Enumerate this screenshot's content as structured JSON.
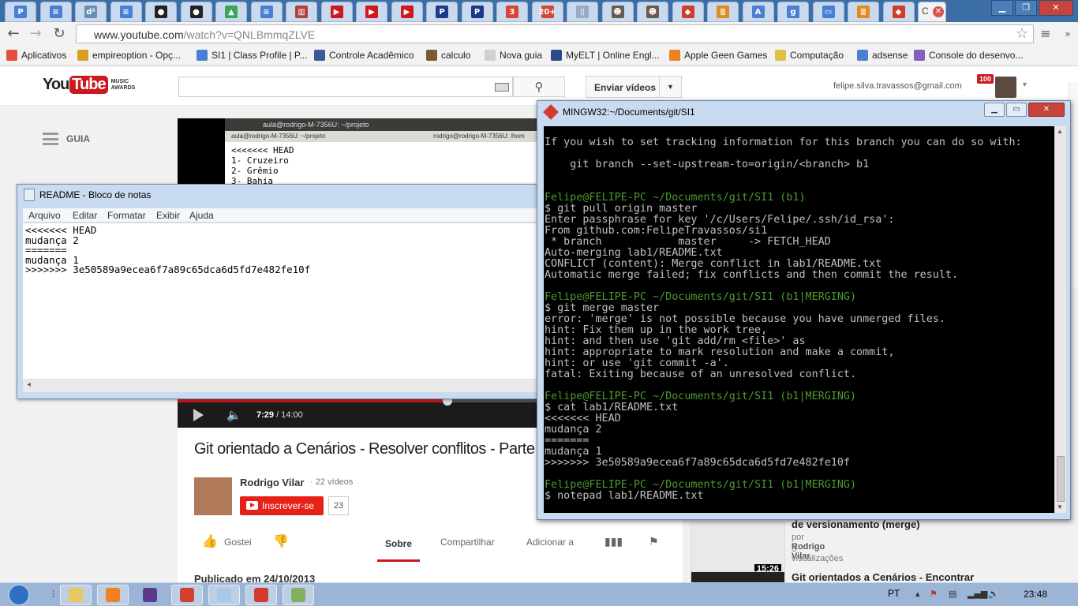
{
  "browser": {
    "url_host": "www.youtube.com",
    "url_path": "/watch?v=QNLBmmqZLVE",
    "tabs": [
      {
        "icon": "p-doc-icon",
        "color": "#4a7fd4",
        "glyph": "P"
      },
      {
        "icon": "docs-icon",
        "color": "#4a7fd4",
        "glyph": "≡"
      },
      {
        "icon": "d2-icon",
        "color": "#6a8fb5",
        "glyph": "d²"
      },
      {
        "icon": "docs-icon",
        "color": "#4a7fd4",
        "glyph": "≡"
      },
      {
        "icon": "github-icon",
        "color": "#222222",
        "glyph": "●"
      },
      {
        "icon": "github-icon",
        "color": "#222222",
        "glyph": "●"
      },
      {
        "icon": "drive-icon",
        "color": "#3aa757",
        "glyph": "▲"
      },
      {
        "icon": "docs-icon",
        "color": "#4a7fd4",
        "glyph": "≡"
      },
      {
        "icon": "books-icon",
        "color": "#b04040",
        "glyph": "▥"
      },
      {
        "icon": "youtube-icon",
        "color": "#cc181e",
        "glyph": "▶"
      },
      {
        "icon": "youtube-icon",
        "color": "#cc181e",
        "glyph": "▶"
      },
      {
        "icon": "youtube-icon",
        "color": "#cc181e",
        "glyph": "▶"
      },
      {
        "icon": "paypal-icon",
        "color": "#1a3a8a",
        "glyph": "P"
      },
      {
        "icon": "paypal-icon",
        "color": "#1a3a8a",
        "glyph": "P"
      },
      {
        "icon": "gmail-icon",
        "color": "#d44638",
        "glyph": "3"
      },
      {
        "icon": "gmail-icon",
        "color": "#d44638",
        "glyph": "20+"
      },
      {
        "icon": "page-icon",
        "color": "#9aaac0",
        "glyph": "▯"
      },
      {
        "icon": "avatar-icon",
        "color": "#6a5a50",
        "glyph": "☻"
      },
      {
        "icon": "avatar-icon",
        "color": "#6a5a50",
        "glyph": "☻"
      },
      {
        "icon": "git-icon",
        "color": "#d23c2f",
        "glyph": "◆"
      },
      {
        "icon": "stack-icon",
        "color": "#e08a20",
        "glyph": "≣"
      },
      {
        "icon": "translate-icon",
        "color": "#4a7fd4",
        "glyph": "A"
      },
      {
        "icon": "google-icon",
        "color": "#4a7fd4",
        "glyph": "g"
      },
      {
        "icon": "monitor-icon",
        "color": "#4a7fd4",
        "glyph": "▭"
      },
      {
        "icon": "stack-icon",
        "color": "#e08a20",
        "glyph": "≣"
      },
      {
        "icon": "git-icon",
        "color": "#d23c2f",
        "glyph": "◆"
      }
    ],
    "active_tab_glyph": "C",
    "bookmarks": [
      {
        "label": "Aplicativos",
        "color": "#e05040"
      },
      {
        "label": "empireoption - Opç...",
        "color": "#d8a020"
      },
      {
        "label": "SI1 | Class Profile | P...",
        "color": "#4a7fd4"
      },
      {
        "label": "Controle Acadêmico",
        "color": "#3a5a9a"
      },
      {
        "label": "calculo",
        "color": "#7a5a30"
      },
      {
        "label": "Nova guia",
        "color": "#d0d0d0"
      },
      {
        "label": "MyELT | Online Engl...",
        "color": "#2a4a8a"
      },
      {
        "label": "Apple Geen Games",
        "color": "#f08020"
      },
      {
        "label": "Computação",
        "color": "#e0c040"
      },
      {
        "label": "adsense",
        "color": "#4a7fd4"
      },
      {
        "label": "Console do desenvo...",
        "color": "#8060c0"
      }
    ]
  },
  "youtube": {
    "logo_you": "You",
    "logo_tube": "Tube",
    "logo_awards_1": "MUSIC",
    "logo_awards_2": "AWARDS",
    "upload_label": "Enviar vídeos",
    "user_email": "felipe.silva.travassos@gmail.com",
    "notifications": "100",
    "guide_label": "GUIA",
    "video_terminal_title": "aula@rodrigo-M-7356U: ~/projeto",
    "video_terminal_tab1": "aula@rodrigo-M-7356U: ~/projeto",
    "video_terminal_tab2": "rodrigo@rodrigo-M-7356U: /hom",
    "video_terminal_lines": [
      "<<<<<<< HEAD",
      "1- Cruzeiro",
      "2- Grêmio",
      "3- Bahia"
    ],
    "time_current": "7:29",
    "time_total": "/ 14:00",
    "progress_fraction": 0.535,
    "title": "Git orientado a Cenários - Resolver conflitos - Parte",
    "channel_name": "Rodrigo Vilar",
    "channel_videos": "· 22 vídeos",
    "subscribe_label": "Inscrever-se",
    "subscriber_count": "23",
    "like_label": "Gostei",
    "tab_about": "Sobre",
    "tab_share": "Compartilhar",
    "tab_add": "Adicionar a",
    "published": "Publicado em 24/10/2013",
    "related": [
      {
        "title": "de versionamento (merge)",
        "by_prefix": "por",
        "by": "Rodrigo Vilar",
        "views": "5 visualizações",
        "duration": "15:26"
      },
      {
        "title": "Git orientados a Cenários - Encontrar"
      }
    ]
  },
  "notepad": {
    "title": "README - Bloco de notas",
    "menu": [
      "Arquivo",
      "Editar",
      "Formatar",
      "Exibir",
      "Ajuda"
    ],
    "lines": [
      "<<<<<<< HEAD",
      "mudança 2",
      "=======",
      "mudança 1",
      ">>>>>>> 3e50589a9ecea6f7a89c65dca6d5fd7e482fe10f"
    ]
  },
  "terminal": {
    "title": "MINGW32:~/Documents/git/SI1",
    "lines": [
      {
        "t": "",
        "c": ""
      },
      {
        "t": "If you wish to set tracking information for this branch you can do so with:",
        "c": ""
      },
      {
        "t": "",
        "c": ""
      },
      {
        "t": "    git branch --set-upstream-to=origin/<branch> b1",
        "c": ""
      },
      {
        "t": "",
        "c": ""
      },
      {
        "t": "",
        "c": ""
      },
      {
        "t": "Felipe@FELIPE-PC ~/Documents/git/SI1 (b1)",
        "c": "g"
      },
      {
        "t": "$ git pull origin master",
        "c": ""
      },
      {
        "t": "Enter passphrase for key '/c/Users/Felipe/.ssh/id_rsa':",
        "c": ""
      },
      {
        "t": "From github.com:FelipeTravassos/si1",
        "c": ""
      },
      {
        "t": " * branch            master     -> FETCH_HEAD",
        "c": ""
      },
      {
        "t": "Auto-merging lab1/README.txt",
        "c": ""
      },
      {
        "t": "CONFLICT (content): Merge conflict in lab1/README.txt",
        "c": ""
      },
      {
        "t": "Automatic merge failed; fix conflicts and then commit the result.",
        "c": ""
      },
      {
        "t": "",
        "c": ""
      },
      {
        "t": "Felipe@FELIPE-PC ~/Documents/git/SI1 (b1|MERGING)",
        "c": "g"
      },
      {
        "t": "$ git merge master",
        "c": ""
      },
      {
        "t": "error: 'merge' is not possible because you have unmerged files.",
        "c": ""
      },
      {
        "t": "hint: Fix them up in the work tree,",
        "c": ""
      },
      {
        "t": "hint: and then use 'git add/rm <file>' as",
        "c": ""
      },
      {
        "t": "hint: appropriate to mark resolution and make a commit,",
        "c": ""
      },
      {
        "t": "hint: or use 'git commit -a'.",
        "c": ""
      },
      {
        "t": "fatal: Exiting because of an unresolved conflict.",
        "c": ""
      },
      {
        "t": "",
        "c": ""
      },
      {
        "t": "Felipe@FELIPE-PC ~/Documents/git/SI1 (b1|MERGING)",
        "c": "g"
      },
      {
        "t": "$ cat lab1/README.txt",
        "c": ""
      },
      {
        "t": "<<<<<<< HEAD",
        "c": ""
      },
      {
        "t": "mudança 2",
        "c": ""
      },
      {
        "t": "=======",
        "c": ""
      },
      {
        "t": "mudança 1",
        "c": ""
      },
      {
        "t": ">>>>>>> 3e50589a9ecea6f7a89c65dca6d5fd7e482fe10f",
        "c": ""
      },
      {
        "t": "",
        "c": ""
      },
      {
        "t": "Felipe@FELIPE-PC ~/Documents/git/SI1 (b1|MERGING)",
        "c": "g"
      },
      {
        "t": "$ notepad lab1/README.txt",
        "c": ""
      }
    ]
  },
  "taskbar": {
    "language": "PT",
    "time": "23:48",
    "apps": [
      {
        "icon": "explorer-icon",
        "color": "#e8c860",
        "open": true
      },
      {
        "icon": "media-player-icon",
        "color": "#f08020",
        "open": true
      },
      {
        "icon": "eclipse-icon",
        "color": "#5a3a8a",
        "open": false
      },
      {
        "icon": "chrome-icon",
        "color": "#d04030",
        "open": true
      },
      {
        "icon": "notepad-icon",
        "color": "#a8c8e8",
        "open": true
      },
      {
        "icon": "git-bash-icon",
        "color": "#d23c2f",
        "open": true
      },
      {
        "icon": "paint-icon",
        "color": "#80b060",
        "open": true
      }
    ]
  }
}
